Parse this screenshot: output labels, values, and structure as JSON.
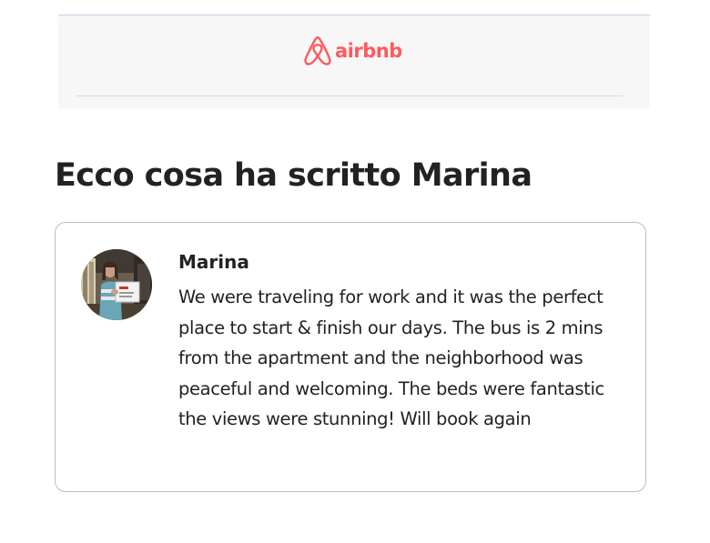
{
  "header": {
    "logo_text": "airbnb",
    "logo_icon": "airbnb-belo-icon",
    "brand_color": "#ff5a5f"
  },
  "main": {
    "title": "Ecco cosa ha scritto Marina"
  },
  "review": {
    "reviewer_name": "Marina",
    "avatar": "reviewer-avatar-photo",
    "text": "We were traveling for work and it was the perfect place to start & finish our days. The bus is 2 mins from the apartment and the neighborhood was peaceful and welcoming. The beds were fantastic the views were stunning! Will book again"
  }
}
